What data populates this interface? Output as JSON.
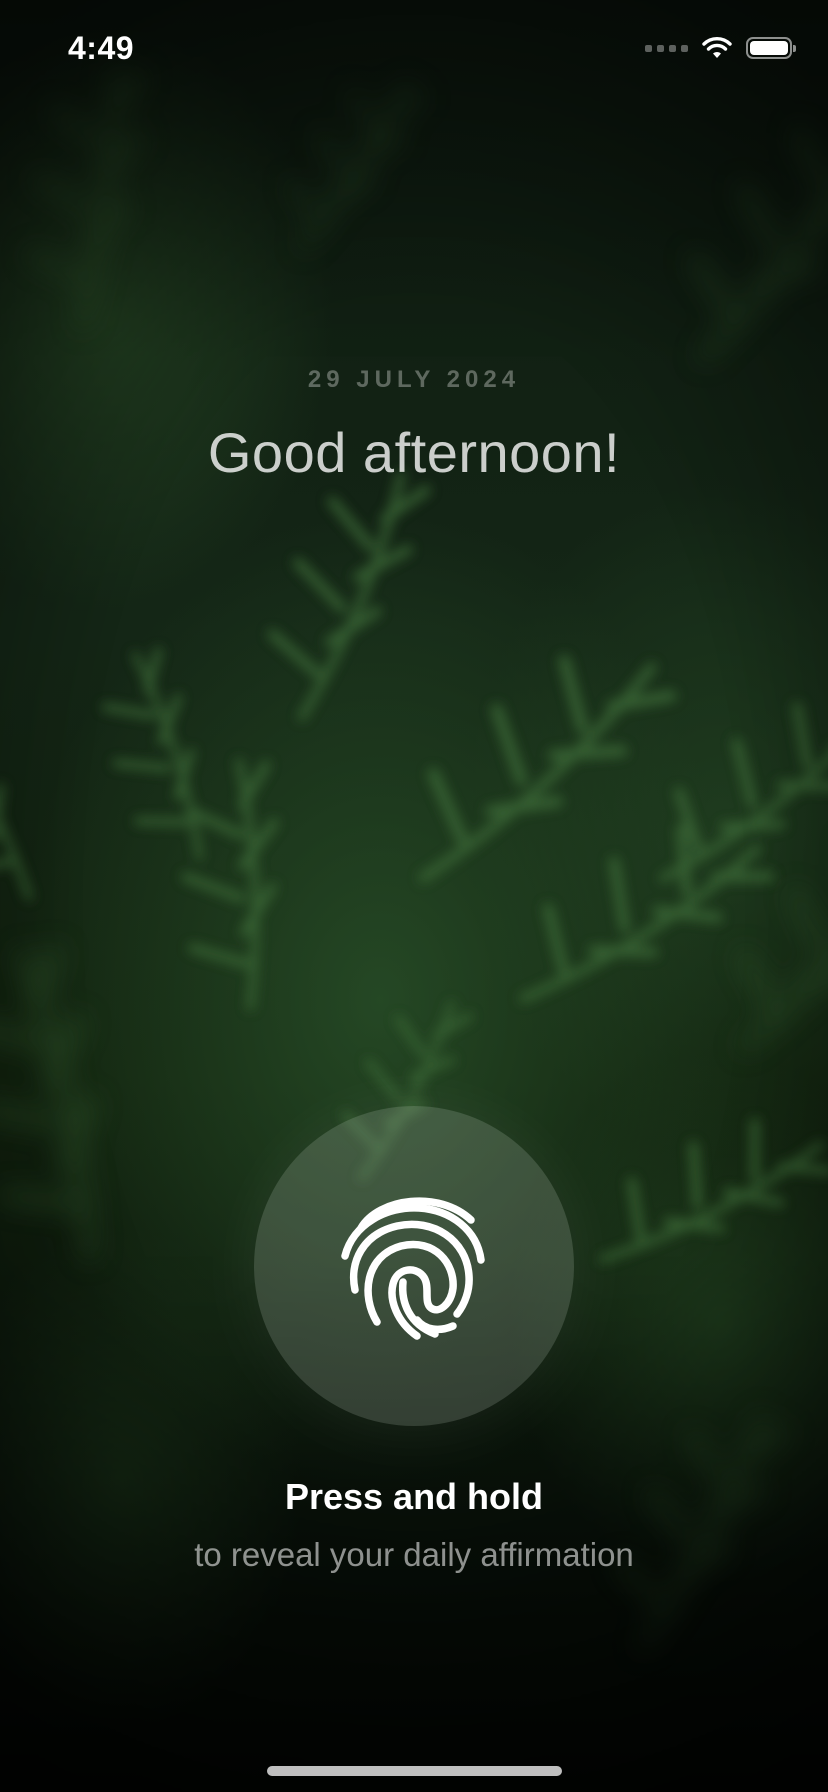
{
  "status_bar": {
    "time": "4:49",
    "battery_level": 1.0,
    "icons": [
      "signal-dots-icon",
      "wifi-icon",
      "battery-icon"
    ]
  },
  "header": {
    "date": "29 JULY 2024",
    "greeting": "Good afternoon!"
  },
  "fingerprint": {
    "icon": "fingerprint-icon"
  },
  "prompt": {
    "title": "Press and hold",
    "subtitle": "to reveal your daily affirmation"
  },
  "colors": {
    "background_dark": "#0b150c",
    "foliage_green": "#2f5a2c",
    "text_primary": "#ffffff"
  }
}
